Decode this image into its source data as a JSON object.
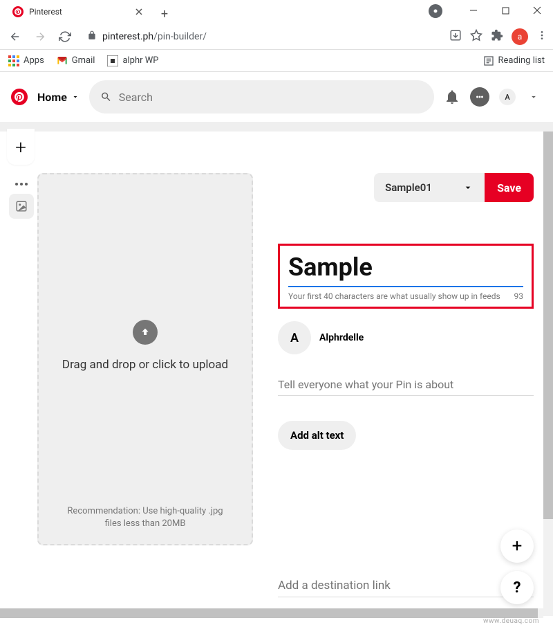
{
  "browser": {
    "tab_title": "Pinterest",
    "url_domain": "pinterest.ph",
    "url_path": "/pin-builder/",
    "bookmarks": {
      "apps": "Apps",
      "gmail": "Gmail",
      "alphr": "alphr WP"
    },
    "reading_list": "Reading list",
    "profile_letter": "a"
  },
  "pinterest": {
    "home": "Home",
    "search_placeholder": "Search",
    "avatar_letter": "A"
  },
  "builder": {
    "board_selected": "Sample01",
    "save": "Save",
    "title_value": "Sample",
    "title_hint": "Your first 40 characters are what usually show up in feeds",
    "title_counter": "93",
    "author_letter": "A",
    "author_name": "Alphrdelle",
    "desc_placeholder": "Tell everyone what your Pin is about",
    "alt_text_btn": "Add alt text",
    "dest_placeholder": "Add a destination link",
    "upload_text": "Drag and drop or click to upload",
    "upload_rec": "Recommendation: Use high-quality .jpg files less than 20MB"
  },
  "fab": {
    "help": "?"
  },
  "watermark": "www.deuaq.com"
}
